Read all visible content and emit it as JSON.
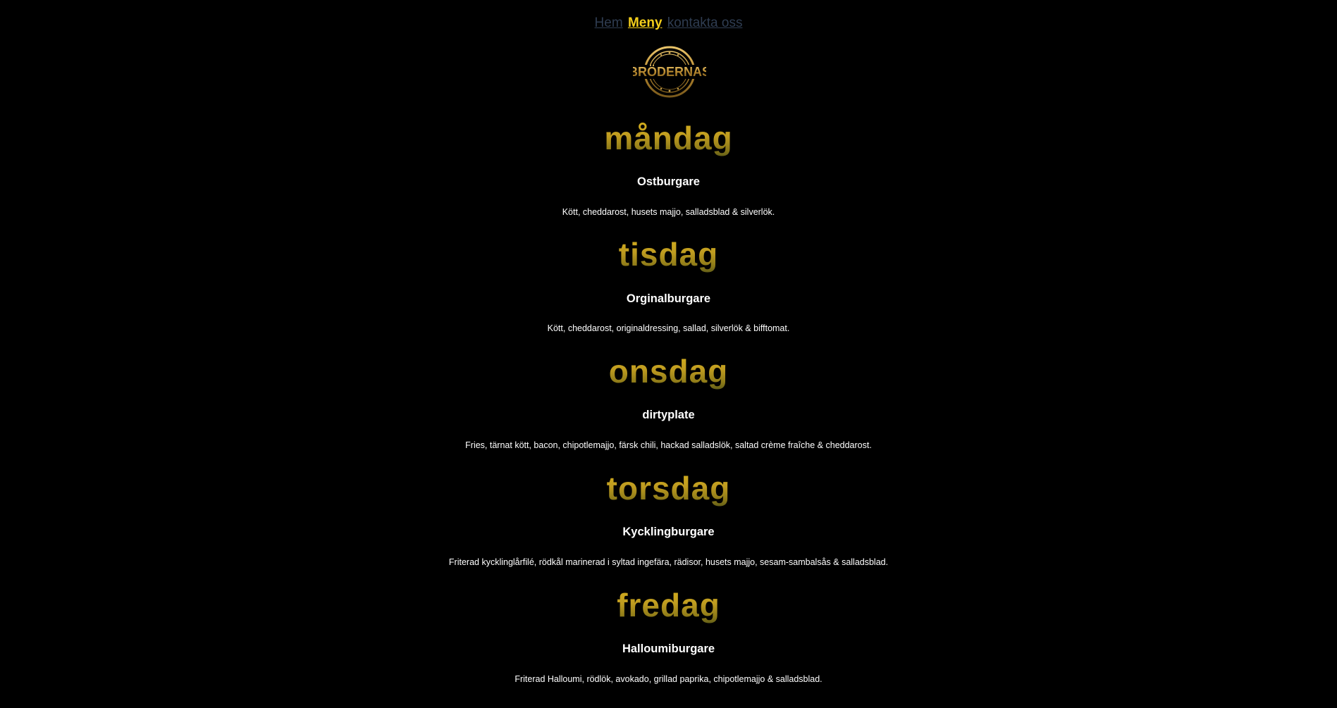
{
  "nav": {
    "items": [
      {
        "label": "Hem",
        "active": false
      },
      {
        "label": "Meny",
        "active": true
      },
      {
        "label": "kontakta oss",
        "active": false
      }
    ]
  },
  "logo": {
    "text": "BRÖDERNAS"
  },
  "menu": [
    {
      "day": "måndag",
      "dish": "Ostburgare",
      "description": "Kött, cheddarost, husets majjo, salladsblad & silverlök."
    },
    {
      "day": "tisdag",
      "dish": "Orginalburgare",
      "description": "Kött, cheddarost, originaldressing, sallad, silverlök & bifftomat."
    },
    {
      "day": "onsdag",
      "dish": "dirtyplate",
      "description": "Fries, tärnat kött, bacon, chipotlemajjo, färsk chili, hackad salladslök, saltad crème fraîche & cheddarost."
    },
    {
      "day": "torsdag",
      "dish": "Kycklingburgare",
      "description": "Friterad kycklinglårfilé, rödkål marinerad i syltad ingefära, rädisor, husets majjo, sesam-sambalsås & salladsblad."
    },
    {
      "day": "fredag",
      "dish": "Halloumiburgare",
      "description": "Friterad Halloumi, rödlök, avokado, grillad paprika, chipotlemajjo & salladsblad."
    }
  ],
  "colors": {
    "background": "#000000",
    "nav_inactive": "#2f3d52",
    "nav_active": "#f5cf1b",
    "gold": "#c9a227"
  }
}
